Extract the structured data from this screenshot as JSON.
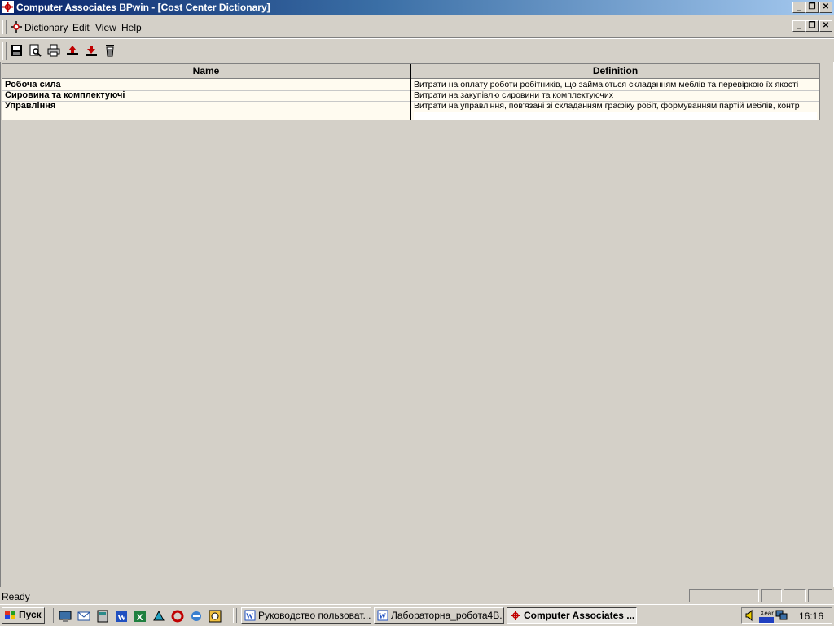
{
  "window": {
    "title": "Computer Associates BPwin - [Cost Center Dictionary]",
    "controls": [
      "_",
      "❐",
      "✕"
    ]
  },
  "menu": {
    "items": [
      {
        "label": "Dictionary"
      },
      {
        "label": "Edit"
      },
      {
        "label": "View"
      },
      {
        "label": "Help"
      }
    ]
  },
  "toolbar": {
    "icons": [
      "save-icon",
      "preview-icon",
      "print-icon",
      "import-icon",
      "export-icon",
      "delete-icon"
    ]
  },
  "grid": {
    "headers": {
      "name": "Name",
      "definition": "Definition"
    },
    "rows": [
      {
        "name": "Робоча сила",
        "definition": "Витрати на оплату роботи робітників, що займаються складанням меблів та перевіркою їх якості"
      },
      {
        "name": "Сировина та комплектуючі",
        "definition": "Витрати на закупівлю сировини та комплектуючих"
      },
      {
        "name": "Управління",
        "definition": "Витрати на управління, пов'язані зі складанням графіку робіт, формуванням партій меблів, контр"
      },
      {
        "name": "",
        "definition": ""
      }
    ]
  },
  "status": {
    "text": "Ready"
  },
  "taskbar": {
    "start_label": "Пуск",
    "tasks": [
      {
        "label": "Руководство пользоват..."
      },
      {
        "label": "Лабораторна_робота4В..."
      },
      {
        "label": "Computer Associates ..."
      }
    ],
    "clock": "16:16",
    "tray_text": "Xear 3D"
  },
  "colors": {
    "title_start": "#0a246a",
    "title_end": "#a6caf0",
    "grid_bg": "#fffbf0",
    "face": "#d4d0c8"
  }
}
